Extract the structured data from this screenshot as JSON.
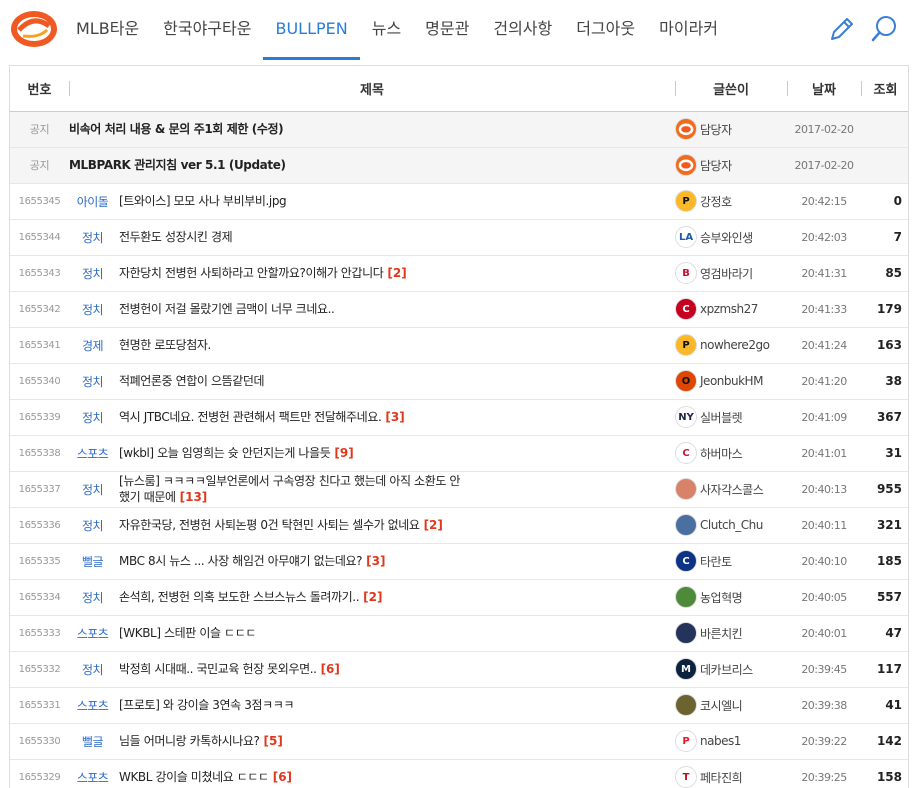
{
  "nav": {
    "items": [
      {
        "label": "MLB타운",
        "active": false
      },
      {
        "label": "한국야구타운",
        "active": false
      },
      {
        "label": "BULLPEN",
        "active": true
      },
      {
        "label": "뉴스",
        "active": false
      },
      {
        "label": "명문관",
        "active": false
      },
      {
        "label": "건의사항",
        "active": false
      },
      {
        "label": "더그아웃",
        "active": false
      },
      {
        "label": "마이라커",
        "active": false
      }
    ],
    "accent": "#2a7cd6",
    "logo_color": "#f05a22",
    "tools": [
      "pencil-icon",
      "search-icon"
    ]
  },
  "table": {
    "headers": {
      "no": "번호",
      "title": "제목",
      "author": "글쓴이",
      "date": "날짜",
      "views": "조회"
    },
    "comment_color": "#e0381c",
    "category_color": "#2c6bc9",
    "rows": [
      {
        "no": "공지",
        "cat": "",
        "title": "비속어 처리 내용 & 문의 주1회 제한 (수정)",
        "comments": "",
        "author": "담당자",
        "team": "mlbpark",
        "date": "2017-02-20",
        "views": "",
        "notice": true
      },
      {
        "no": "공지",
        "cat": "",
        "title": "MLBPARK 관리지침 ver 5.1 (Update)",
        "comments": "",
        "author": "담당자",
        "team": "mlbpark",
        "date": "2017-02-20",
        "views": "",
        "notice": true
      },
      {
        "no": "1655345",
        "cat": "아이돌",
        "title": "[트와이스] 모모 사나 부비부비.jpg",
        "comments": "",
        "author": "강정호",
        "team": "pirates",
        "date": "20:42:15",
        "views": "0"
      },
      {
        "no": "1655344",
        "cat": "정치",
        "title": "전두환도 성장시킨 경제",
        "comments": "",
        "author": "승부와인생",
        "team": "dodgers",
        "date": "20:42:03",
        "views": "7"
      },
      {
        "no": "1655343",
        "cat": "정치",
        "title": "자한당치 전병헌 사퇴하라고 안할까요?이해가 안갑니다",
        "comments": "[2]",
        "author": "영검바라기",
        "team": "redsox",
        "date": "20:41:31",
        "views": "85"
      },
      {
        "no": "1655342",
        "cat": "정치",
        "title": "전병헌이 저걸 몰랐기엔 금맥이 너무 크네요..",
        "comments": "",
        "author": "xpzmsh27",
        "team": "reds",
        "date": "20:41:33",
        "views": "179"
      },
      {
        "no": "1655341",
        "cat": "경제",
        "title": "현명한 로또당첨자.",
        "comments": "",
        "author": "nowhere2go",
        "team": "pirates",
        "date": "20:41:24",
        "views": "163"
      },
      {
        "no": "1655340",
        "cat": "정치",
        "title": "적폐언론중 연합이 으뜸같던데",
        "comments": "",
        "author": "JeonbukHM",
        "team": "orioles",
        "date": "20:41:20",
        "views": "38"
      },
      {
        "no": "1655339",
        "cat": "정치",
        "title": "역시 JTBC네요. 전병헌 관련해서 팩트만 전달해주네요.",
        "comments": "[3]",
        "author": "실버블렛",
        "team": "yankees",
        "date": "20:41:09",
        "views": "367"
      },
      {
        "no": "1655338",
        "cat": "스포츠",
        "title": "[wkbl] 오늘 임영희는 슛 안던지는게 나을듯",
        "comments": "[9]",
        "author": "하버마스",
        "team": "cardinals",
        "date": "20:41:01",
        "views": "31"
      },
      {
        "no": "1655337",
        "cat": "정치",
        "title": "[뉴스룸] ㅋㅋㅋㅋ일부언론에서 구속영장 친다고 했는데 아직 소환도 안했기 때문에",
        "comments": "[13]",
        "author": "사자각스콜스",
        "team": "photo",
        "date": "20:40:13",
        "views": "955"
      },
      {
        "no": "1655336",
        "cat": "정치",
        "title": "자유한국당, 전병헌 사퇴논평 0건 탁현민 사퇴는 셀수가 없네요",
        "comments": "[2]",
        "author": "Clutch_Chu",
        "team": "player",
        "date": "20:40:11",
        "views": "321"
      },
      {
        "no": "1655335",
        "cat": "뻘글",
        "title": "MBC 8시 뉴스 ... 사장 해임건 아무얘기 없는데요?",
        "comments": "[3]",
        "author": "타란토",
        "team": "cubs",
        "date": "20:40:10",
        "views": "185"
      },
      {
        "no": "1655334",
        "cat": "정치",
        "title": "손석희, 전병헌 의혹 보도한 스브스뉴스 돌려까기..",
        "comments": "[2]",
        "author": "농업혁명",
        "team": "frog",
        "date": "20:40:05",
        "views": "557"
      },
      {
        "no": "1655333",
        "cat": "스포츠",
        "title": "[WKBL] 스테판 이슬 ㄷㄷㄷ",
        "comments": "",
        "author": "바른치킨",
        "team": "player2",
        "date": "20:40:01",
        "views": "47"
      },
      {
        "no": "1655332",
        "cat": "정치",
        "title": "박정희 시대때.. 국민교육 헌장 못외우면..",
        "comments": "[6]",
        "author": "데카브리스",
        "team": "twins",
        "date": "20:39:45",
        "views": "117"
      },
      {
        "no": "1655331",
        "cat": "스포츠",
        "title": "[프로토] 와 강이슬 3연속 3점ㅋㅋㅋ",
        "comments": "",
        "author": "코시엘니",
        "team": "photo2",
        "date": "20:39:38",
        "views": "41"
      },
      {
        "no": "1655330",
        "cat": "뻘글",
        "title": "님들 어머니랑 카톡하시나요?",
        "comments": "[5]",
        "author": "nabes1",
        "team": "phillies",
        "date": "20:39:22",
        "views": "142"
      },
      {
        "no": "1655329",
        "cat": "스포츠",
        "title": "WKBL 강이슬 미쳤네요 ㄷㄷㄷ",
        "comments": "[6]",
        "author": "페타진희",
        "team": "rangers",
        "date": "20:39:25",
        "views": "158"
      }
    ]
  },
  "teams": {
    "mlbpark": {
      "glyph": "",
      "bg": "#f26b1d",
      "fg": "#ffffff"
    },
    "pirates": {
      "glyph": "P",
      "bg": "#fdb827",
      "fg": "#111111"
    },
    "dodgers": {
      "glyph": "LA",
      "bg": "#ffffff",
      "fg": "#1e5aa8"
    },
    "redsox": {
      "glyph": "B",
      "bg": "#ffffff",
      "fg": "#c8102e"
    },
    "reds": {
      "glyph": "C",
      "bg": "#c6011f",
      "fg": "#ffffff"
    },
    "orioles": {
      "glyph": "O",
      "bg": "#df4601",
      "fg": "#111111"
    },
    "yankees": {
      "glyph": "NY",
      "bg": "#ffffff",
      "fg": "#1c2841"
    },
    "cardinals": {
      "glyph": "C",
      "bg": "#ffffff",
      "fg": "#c41e3a"
    },
    "photo": {
      "glyph": "",
      "bg": "#d9826a",
      "fg": "#ffffff"
    },
    "player": {
      "glyph": "",
      "bg": "#4a6fa0",
      "fg": "#ffffff"
    },
    "cubs": {
      "glyph": "C",
      "bg": "#0e3386",
      "fg": "#ffffff"
    },
    "frog": {
      "glyph": "",
      "bg": "#4f8a3a",
      "fg": "#ffffff"
    },
    "player2": {
      "glyph": "",
      "bg": "#23335a",
      "fg": "#ffffff"
    },
    "twins": {
      "glyph": "M",
      "bg": "#0c2340",
      "fg": "#ffffff"
    },
    "photo2": {
      "glyph": "",
      "bg": "#6b6330",
      "fg": "#ffffff"
    },
    "phillies": {
      "glyph": "P",
      "bg": "#ffffff",
      "fg": "#e81828"
    },
    "rangers": {
      "glyph": "T",
      "bg": "#ffffff",
      "fg": "#c0111f"
    }
  }
}
